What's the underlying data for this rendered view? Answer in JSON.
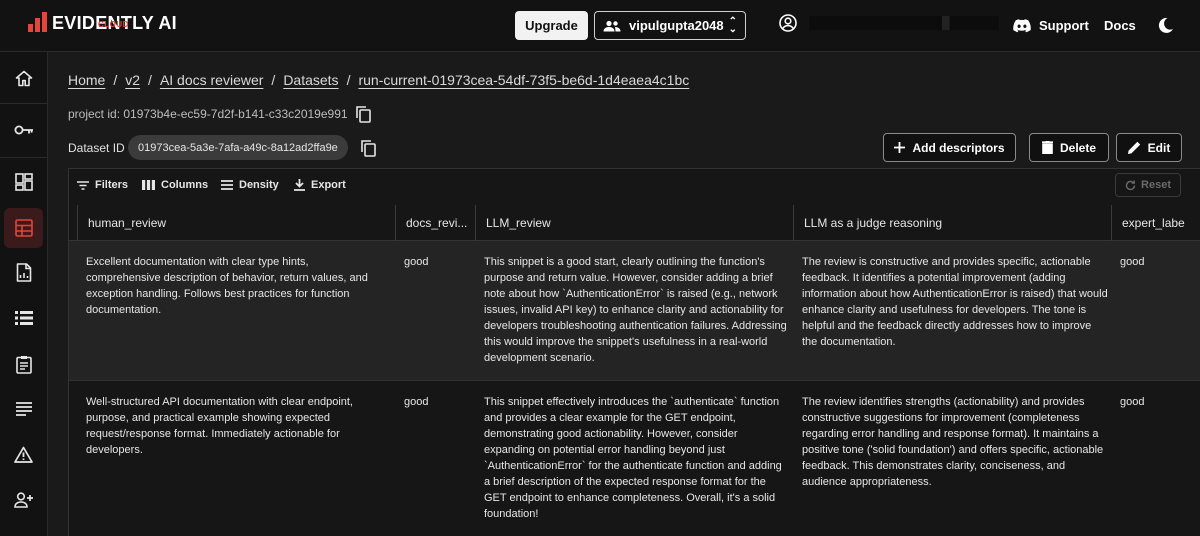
{
  "brand": {
    "name": "EVIDENTLY AI",
    "sub": "CLOUD",
    "accent": "#e5453b"
  },
  "topbar": {
    "upgrade_label": "Upgrade",
    "org_name": "vipulgupta2048",
    "support_label": "Support",
    "docs_label": "Docs"
  },
  "sidebar": {
    "items": [
      {
        "icon": "home-icon"
      },
      {
        "icon": "key-icon"
      },
      {
        "icon": "dashboard-icon"
      },
      {
        "icon": "datasets-icon",
        "active": true
      },
      {
        "icon": "reports-icon"
      },
      {
        "icon": "list-icon"
      },
      {
        "icon": "clipboard-icon"
      },
      {
        "icon": "traces-icon"
      },
      {
        "icon": "alert-icon"
      },
      {
        "icon": "add-user-icon"
      }
    ]
  },
  "breadcrumb": {
    "home": "Home",
    "project": "v2",
    "reviewer": "AI docs reviewer",
    "datasets": "Datasets",
    "run": "run-current-01973cea-54df-73f5-be6d-1d4eaea4c1bc"
  },
  "project_id_text": "project id: 01973b4e-ec59-7d2f-b141-c33c2019e991",
  "dataset": {
    "label": "Dataset ID",
    "id": "01973cea-5a3e-7afa-a49c-8a12ad2ffa9e"
  },
  "actions": {
    "add_descriptors": "Add descriptors",
    "delete": "Delete",
    "edit": "Edit"
  },
  "toolbar": {
    "filters": "Filters",
    "columns": "Columns",
    "density": "Density",
    "export": "Export",
    "reset": "Reset"
  },
  "table": {
    "columns": [
      "human_review",
      "docs_revi...",
      "LLM_review",
      "LLM as a judge reasoning",
      "expert_labe"
    ],
    "rows": [
      {
        "human_review": "Excellent documentation with clear type hints, comprehensive description of behavior, return values, and exception handling. Follows best practices for function documentation.",
        "docs_review": "good",
        "llm_review": "This snippet is a good start, clearly outlining the function's purpose and return value. However, consider adding a brief note about how `AuthenticationError` is raised (e.g., network issues, invalid API key) to enhance clarity and actionability for developers troubleshooting authentication failures. Addressing this would improve the snippet's usefulness in a real-world development scenario.",
        "judge_reasoning": "The review is constructive and provides specific, actionable feedback. It identifies a potential improvement (adding information about how AuthenticationError is raised) that would enhance clarity and usefulness for developers. The tone is helpful and the feedback directly addresses how to improve the documentation.",
        "expert_label": "good"
      },
      {
        "human_review": "Well-structured API documentation with clear endpoint, purpose, and practical example showing expected request/response format. Immediately actionable for developers.",
        "docs_review": "good",
        "llm_review": "This snippet effectively introduces the `authenticate` function and provides a clear example for the GET endpoint, demonstrating good actionability. However, consider expanding on potential error handling beyond just `AuthenticationError` for the authenticate function and adding a brief description of the expected response format for the GET endpoint to enhance completeness. Overall, it's a solid foundation!",
        "judge_reasoning": "The review identifies strengths (actionability) and provides constructive suggestions for improvement (completeness regarding error handling and response format). It maintains a positive tone ('solid foundation') and offers specific, actionable feedback. This demonstrates clarity, conciseness, and audience appropriateness.",
        "expert_label": "good"
      }
    ]
  }
}
